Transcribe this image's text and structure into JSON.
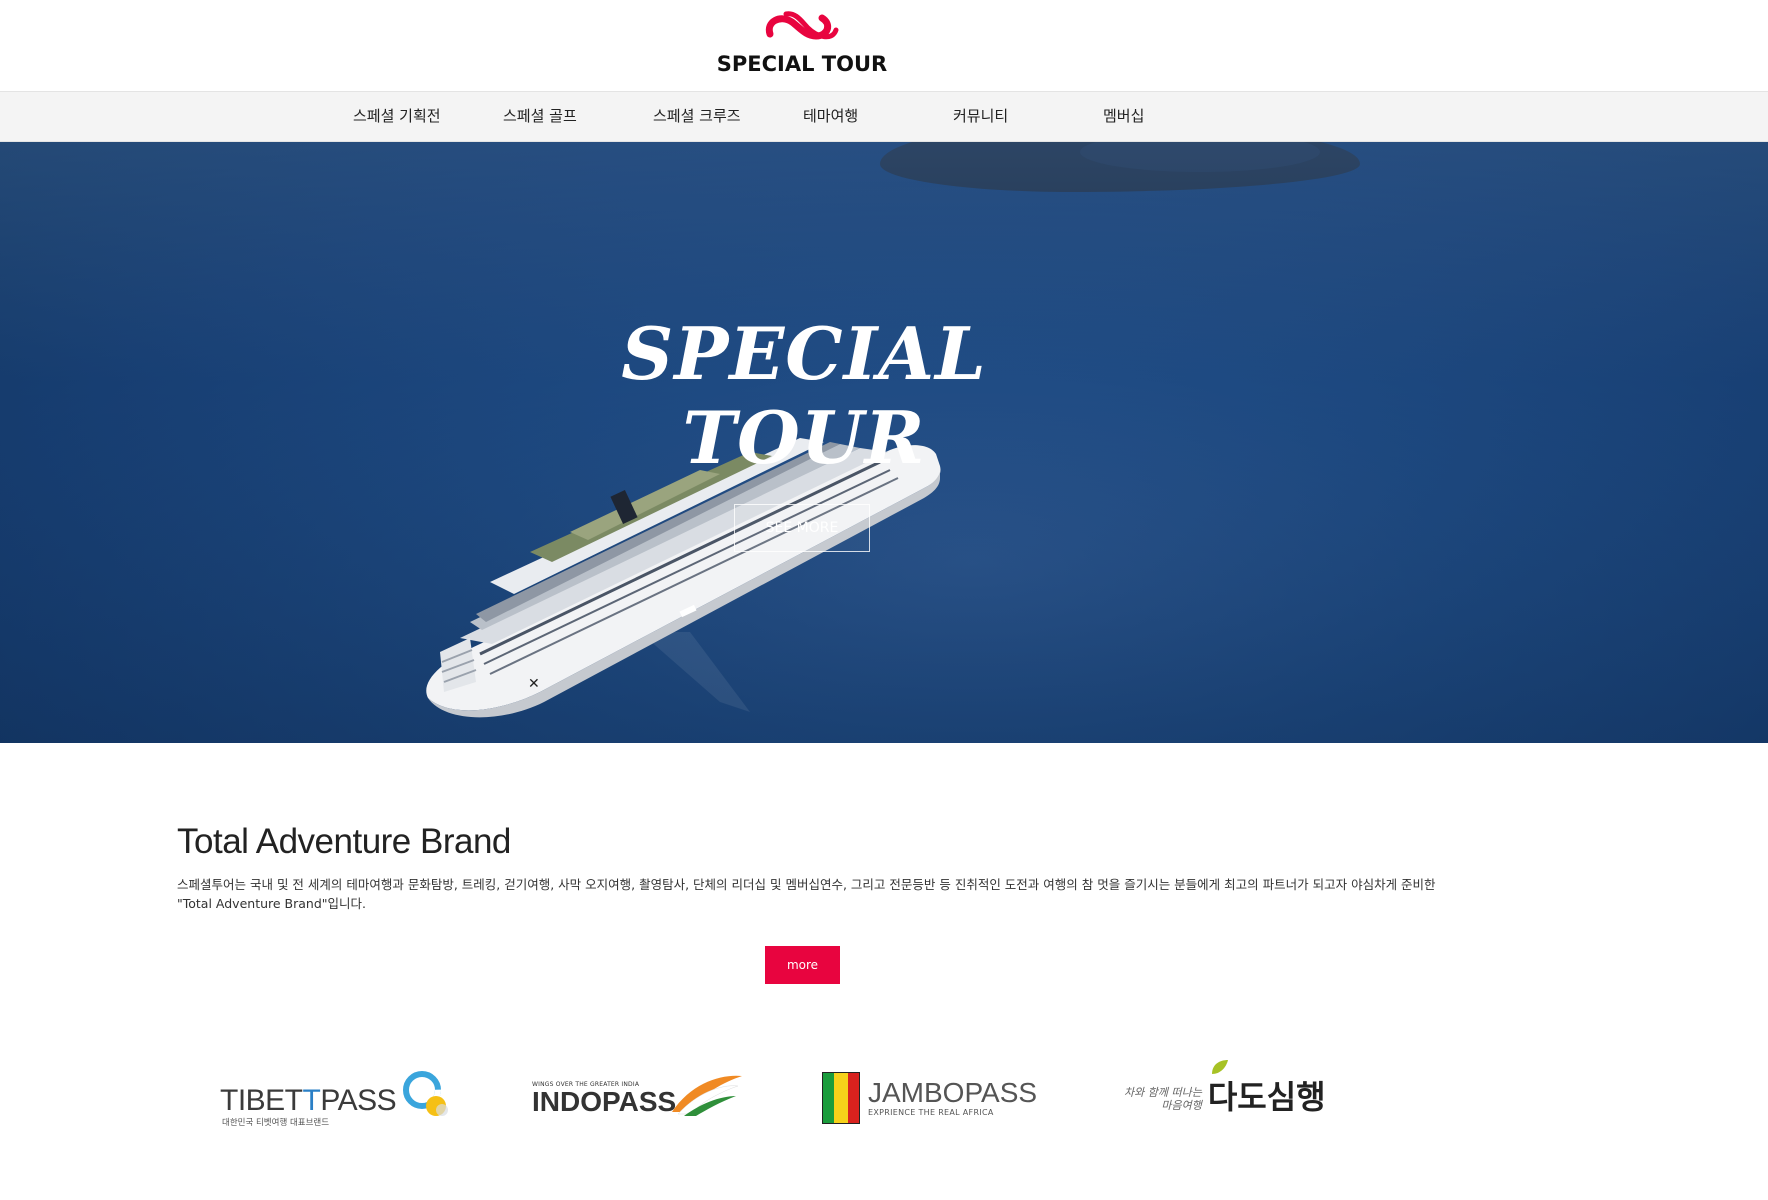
{
  "header": {
    "logo_text": "SPECIAL TOUR",
    "logo_icon": "special-tour-logo-icon",
    "brand_color": "#e8043f"
  },
  "nav": {
    "items": [
      {
        "label": "스페셜 기획전"
      },
      {
        "label": "스페셜 골프"
      },
      {
        "label": "스페셜 크루즈"
      },
      {
        "label": "테마여행"
      },
      {
        "label": "커뮤니티"
      },
      {
        "label": "멤버십"
      }
    ]
  },
  "hero": {
    "title_line1": "SPECIAL",
    "title_line2": "TOUR",
    "button_label": "SEE MORE",
    "image": "cruise-ship-aerial"
  },
  "brand": {
    "title": "Total Adventure Brand",
    "description_line1": "스페셜투어는 국내 및 전 세계의 테마여행과 문화탐방, 트레킹, 걷기여행, 사막 오지여행,  촬영탐사, 단체의 리더십 및 멤버십연수, 그리고 전문등반 등 진취적인 도전과 여행의 참 멋을 즐기시는 분들에게 최고의 파트너가 되고자 야심차게 준비한",
    "description_line2": "\"Total Adventure Brand\"입니다.",
    "more_label": "more"
  },
  "partners": {
    "tibet": {
      "name_a": "TIBET",
      "name_b": "T",
      "name_c": "PASS",
      "sub": "대한민국 티벳여행 대표브랜드"
    },
    "indo": {
      "small": "WINGS OVER THE GREATER INDIA",
      "name": "INDOPASS"
    },
    "jambo": {
      "name": "JAMBOPASS",
      "sub": "EXPRIENCE THE REAL AFRICA"
    },
    "dado": {
      "script_line1": "차와 함께 떠나는",
      "script_line2": "마음여행",
      "name": "다도심행"
    }
  }
}
